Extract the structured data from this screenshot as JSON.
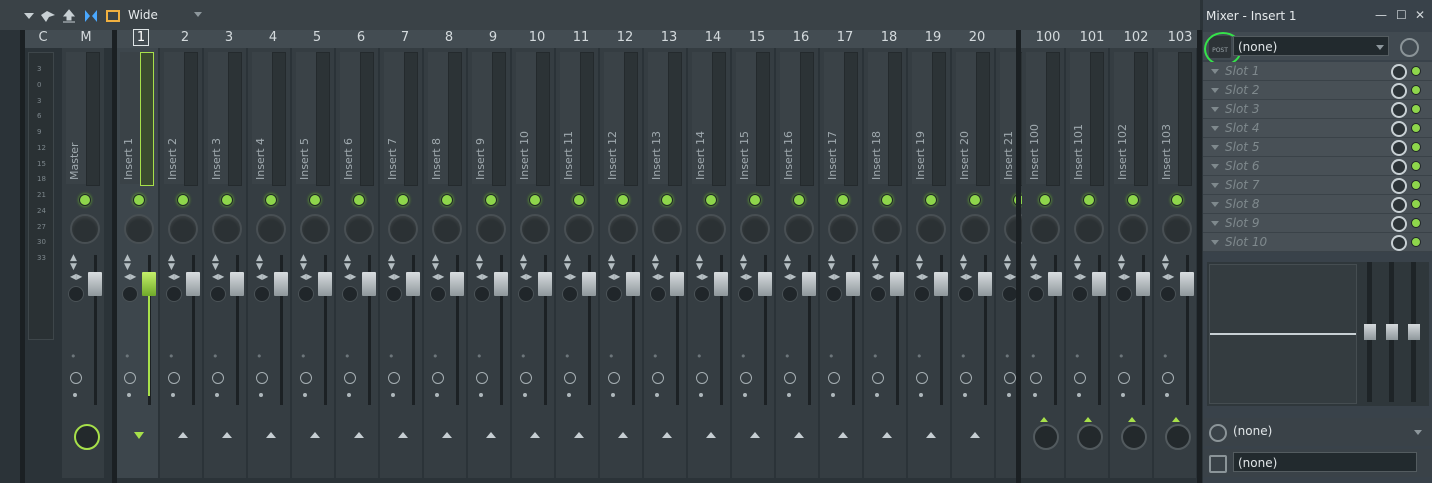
{
  "toolbar": {
    "preset": "Wide"
  },
  "header": {
    "left": [
      {
        "label": "C"
      },
      {
        "label": "M"
      }
    ],
    "inserts": [
      "1",
      "2",
      "3",
      "4",
      "5",
      "6",
      "7",
      "8",
      "9",
      "10",
      "11",
      "12",
      "13",
      "14",
      "15",
      "16",
      "17",
      "18",
      "19",
      "20"
    ],
    "right": [
      "100",
      "101",
      "102",
      "103"
    ]
  },
  "scale_ticks": [
    "3",
    "0",
    "3",
    "6",
    "9",
    "12",
    "15",
    "18",
    "21",
    "24",
    "27",
    "30",
    "33"
  ],
  "tracks": {
    "master": "Master",
    "inserts": [
      "Insert 1",
      "Insert 2",
      "Insert 3",
      "Insert 4",
      "Insert 5",
      "Insert 6",
      "Insert 7",
      "Insert 8",
      "Insert 9",
      "Insert 10",
      "Insert 11",
      "Insert 12",
      "Insert 13",
      "Insert 14",
      "Insert 15",
      "Insert 16",
      "Insert 17",
      "Insert 18",
      "Insert 19",
      "Insert 20",
      "Insert 21"
    ],
    "right": [
      "Insert 100",
      "Insert 101",
      "Insert 102",
      "Insert 103"
    ]
  },
  "panel": {
    "title": "Mixer - Insert 1",
    "input": "(none)",
    "slots": [
      "Slot 1",
      "Slot 2",
      "Slot 3",
      "Slot 4",
      "Slot 5",
      "Slot 6",
      "Slot 7",
      "Slot 8",
      "Slot 9",
      "Slot 10"
    ],
    "delay": "(none)",
    "output": "(none)",
    "post_label": "POST"
  },
  "colors": {
    "accent": "#a7e04a",
    "highlight": "#35e24a",
    "background": "#2b3338"
  }
}
